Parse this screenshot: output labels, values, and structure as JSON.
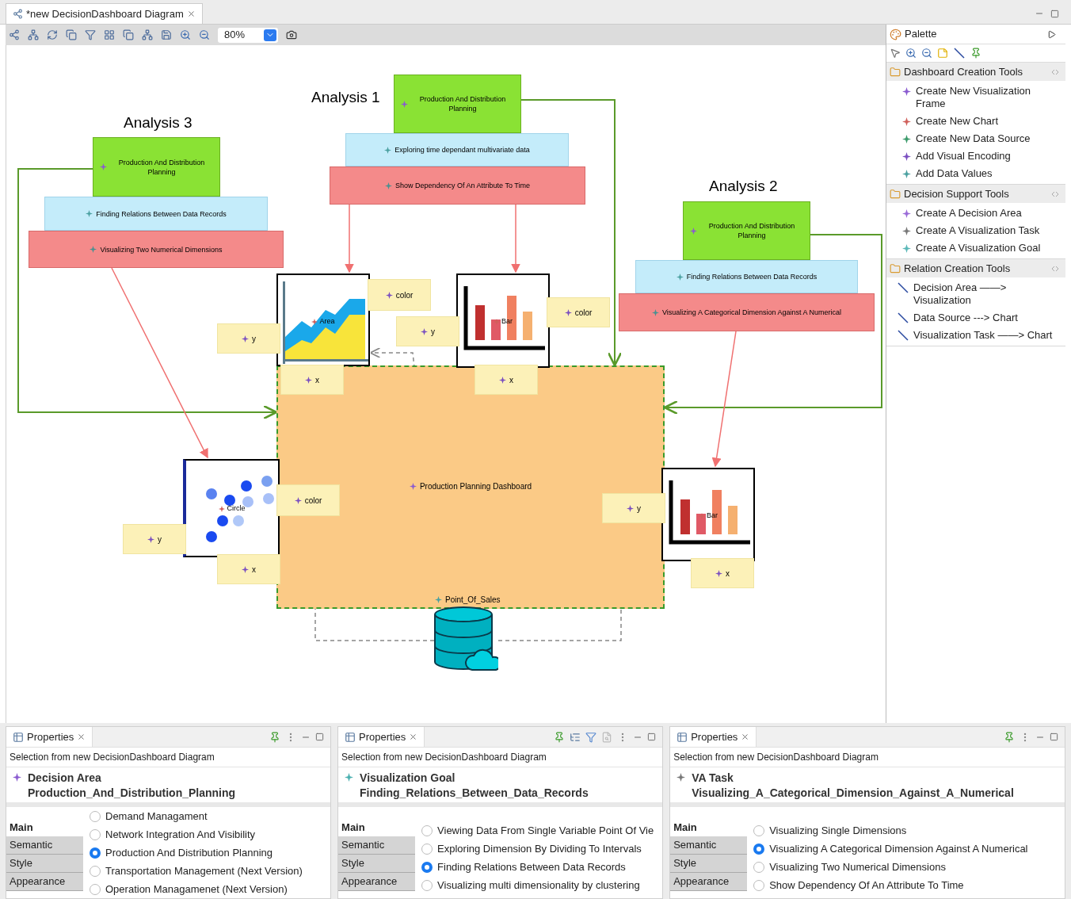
{
  "editor_tab": {
    "title": "*new DecisionDashboard Diagram"
  },
  "toolbar": {
    "zoom": "80%"
  },
  "diagram": {
    "analyses": [
      {
        "title": "Analysis 1",
        "decision_area": "Production And Distribution Planning",
        "goal": "Exploring time dependant multivariate data",
        "task": "Show Dependency Of An Attribute To Time"
      },
      {
        "title": "Analysis 3",
        "decision_area": "Production And Distribution Planning",
        "goal": "Finding Relations Between Data Records",
        "task": "Visualizing Two Numerical Dimensions"
      },
      {
        "title": "Analysis 2",
        "decision_area": "Production And Distribution Planning",
        "goal": "Finding Relations Between Data Records",
        "task": "Visualizing A Categorical Dimension Against A Numerical"
      }
    ],
    "dashboard": "Production Planning Dashboard",
    "data_source": "Point_Of_Sales",
    "charts": [
      {
        "kind": "area",
        "label": "Area"
      },
      {
        "kind": "bar",
        "label": "Bar"
      },
      {
        "kind": "scatter",
        "label": "Circle"
      },
      {
        "kind": "bar",
        "label": "Bar"
      }
    ],
    "encodings": [
      "color",
      "color",
      "y",
      "y",
      "x",
      "x",
      "color",
      "y",
      "y",
      "x",
      "x"
    ]
  },
  "palette": {
    "title": "Palette",
    "groups": [
      {
        "title": "Dashboard Creation Tools",
        "items": [
          {
            "kind": "node",
            "label": "Create New Visualization Frame",
            "color": "#8a5bd0"
          },
          {
            "kind": "node",
            "label": "Create New Chart",
            "color": "#d0605b"
          },
          {
            "kind": "node",
            "label": "Create New Data Source",
            "color": "#3a9a6a"
          },
          {
            "kind": "node",
            "label": "Add Visual Encoding",
            "color": "#7a4fc0"
          },
          {
            "kind": "node",
            "label": "Add Data Values",
            "color": "#4aa0a0"
          }
        ]
      },
      {
        "title": "Decision Support Tools",
        "items": [
          {
            "kind": "node",
            "label": "Create A Decision Area",
            "color": "#9a6ad8"
          },
          {
            "kind": "node",
            "label": "Create A Visualization Task",
            "color": "#777777"
          },
          {
            "kind": "node",
            "label": "Create A Visualization Goal",
            "color": "#5ab8b8"
          }
        ]
      },
      {
        "title": "Relation Creation Tools",
        "items": [
          {
            "kind": "relation",
            "label": "Decision Area ——> Visualization"
          },
          {
            "kind": "relation",
            "label": "Data Source ---> Chart"
          },
          {
            "kind": "relation",
            "label": "Visualization Task ——> Chart"
          }
        ]
      }
    ]
  },
  "properties_panels": [
    {
      "title": "Properties",
      "subtitle": "Selection from new DecisionDashboard Diagram",
      "element_type": "Decision Area",
      "element_name": "Production_And_Distribution_Planning",
      "color": "#8a5bd0",
      "tabs": [
        {
          "label": "Main",
          "selected": true
        },
        {
          "label": "Semantic",
          "selected": false
        },
        {
          "label": "Style",
          "selected": false
        },
        {
          "label": "Appearance",
          "selected": false
        }
      ],
      "options": [
        {
          "label": "Demand Managament",
          "selected": false
        },
        {
          "label": "Network Integration And Visibility",
          "selected": false
        },
        {
          "label": "Production And Distribution Planning",
          "selected": true
        },
        {
          "label": "Transportation Management  (Next Version)",
          "selected": false
        },
        {
          "label": "Operation Managamenet  (Next Version)",
          "selected": false
        }
      ]
    },
    {
      "title": "Properties",
      "subtitle": "Selection from new DecisionDashboard Diagram",
      "element_type": "Visualization Goal",
      "element_name": "Finding_Relations_Between_Data_Records",
      "color": "#4ab0b0",
      "tabs": [
        {
          "label": "Main",
          "selected": true
        },
        {
          "label": "Semantic",
          "selected": false
        },
        {
          "label": "Style",
          "selected": false
        },
        {
          "label": "Appearance",
          "selected": false
        }
      ],
      "options": [
        {
          "label": "Viewing Data From Single Variable Point Of Vie",
          "selected": false
        },
        {
          "label": "Exploring Dimension By Dividing To Intervals",
          "selected": false
        },
        {
          "label": "Finding Relations Between Data Records",
          "selected": true
        },
        {
          "label": "Visualizing multi dimensionality by clustering",
          "selected": false
        }
      ]
    },
    {
      "title": "Properties",
      "subtitle": "Selection from new DecisionDashboard Diagram",
      "element_type": "VA Task",
      "element_name": "Visualizing_A_Categorical_Dimension_Against_A_Numerical",
      "color": "#777777",
      "tabs": [
        {
          "label": "Main",
          "selected": true
        },
        {
          "label": "Semantic",
          "selected": false
        },
        {
          "label": "Style",
          "selected": false
        },
        {
          "label": "Appearance",
          "selected": false
        }
      ],
      "options": [
        {
          "label": "Visualizing Single Dimensions",
          "selected": false
        },
        {
          "label": "Visualizing A Categorical Dimension Against A Numerical",
          "selected": true
        },
        {
          "label": "Visualizing Two Numerical Dimensions",
          "selected": false
        },
        {
          "label": "Show Dependency Of An Attribute To Time",
          "selected": false
        }
      ]
    }
  ]
}
